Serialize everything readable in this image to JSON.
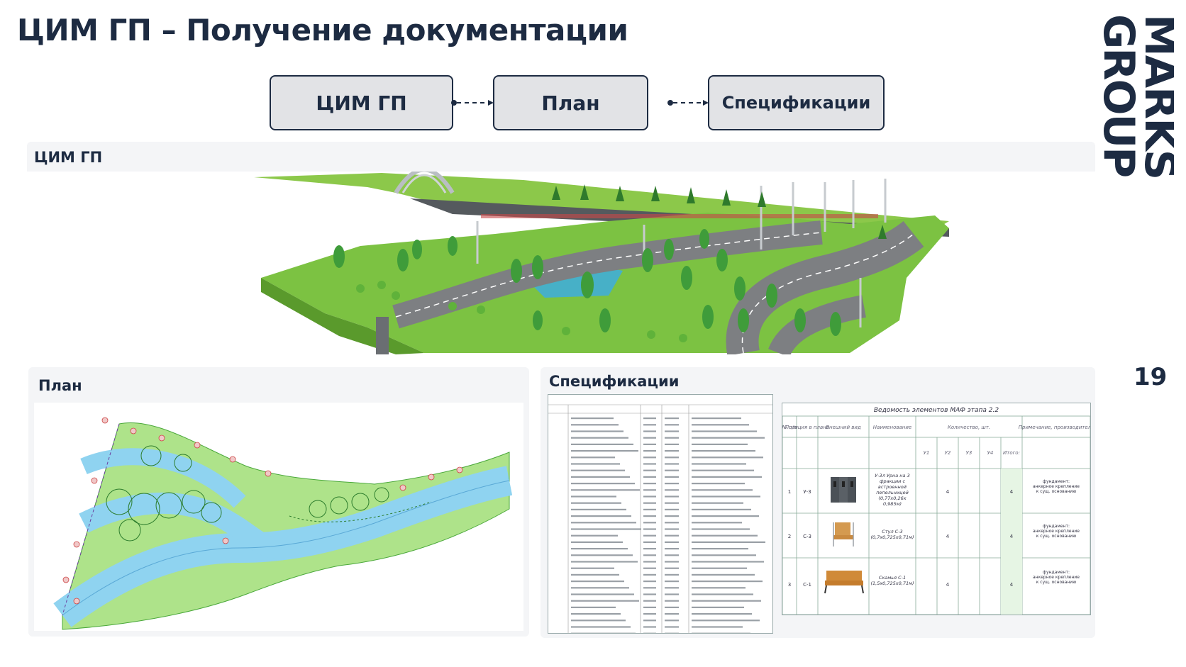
{
  "title": "ЦИМ ГП – Получение документации",
  "brand": {
    "line1": "MARKS",
    "line2": "GROUP"
  },
  "page_number": "19",
  "flow": {
    "step1": "ЦИМ ГП",
    "step2": "План",
    "step3": "Спецификации"
  },
  "sections": {
    "model": "ЦИМ ГП",
    "plan": "План",
    "specs": "Спецификации"
  },
  "spec_table": {
    "title": "Ведомость элементов МАФ этапа 2.2",
    "headers": {
      "num": "№ п/п",
      "position": "Позиция в плане",
      "view": "Внешний вид",
      "name": "Наименование",
      "qty": "Количество, шт.",
      "note": "Примечание, производитель",
      "u1": "У1",
      "u2": "У2",
      "u3": "У3",
      "u4": "У4",
      "total": "Итого:"
    },
    "rows": [
      {
        "num": "1",
        "pos": "У-3",
        "name": "У-3л Урна на 3 фракции с встроенной пепельницей (0,77х0,26х 0,985м)",
        "u2": "4",
        "total": "4",
        "note": "фундамент: анкерное крепление к сущ. основанию"
      },
      {
        "num": "2",
        "pos": "С-3",
        "name": "Стул С-3 (0,7х0,725х0,71м)",
        "u2": "4",
        "total": "4",
        "note": "фундамент: анкерное крепление к сущ. основанию"
      },
      {
        "num": "3",
        "pos": "С-1",
        "name": "Скамья С-1 (1,5х0,725х0,71м)",
        "u2": "4",
        "total": "4",
        "note": "фундамент: анкерное крепление к сущ. основанию"
      }
    ]
  },
  "colors": {
    "navy": "#1d2b42",
    "panel": "#f4f5f7",
    "box": "#e2e3e6",
    "grass": "#7cc242",
    "road": "#8a8c8f",
    "water": "#9fd7f0"
  },
  "icons": [
    "urn-3d-icon",
    "chair-3d-icon",
    "bench-3d-icon"
  ]
}
